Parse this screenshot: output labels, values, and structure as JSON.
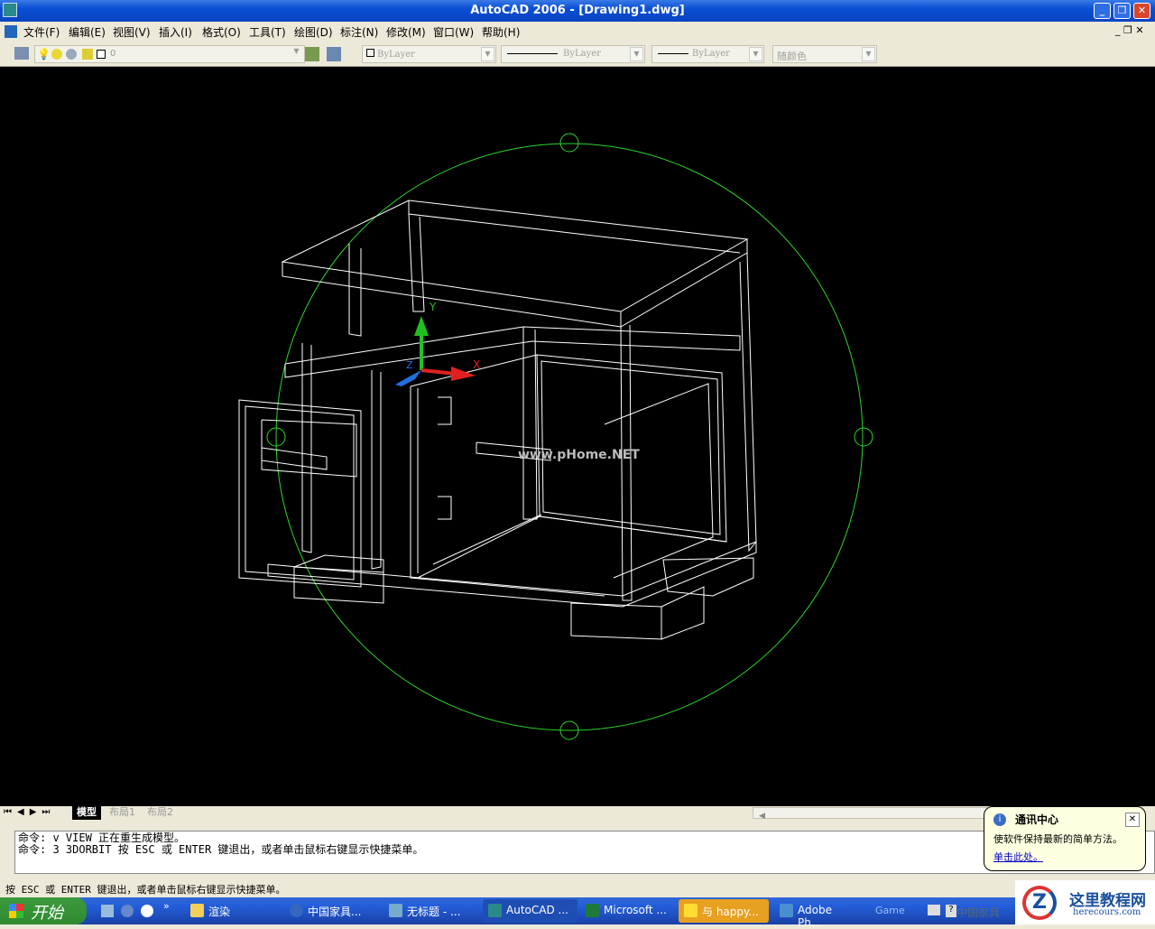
{
  "window": {
    "title": "AutoCAD 2006 - [Drawing1.dwg]",
    "min": "_",
    "restore": "❐",
    "close": "✕"
  },
  "menu": [
    "文件(F)",
    "编辑(E)",
    "视图(V)",
    "插入(I)",
    "格式(O)",
    "工具(T)",
    "绘图(D)",
    "标注(N)",
    "修改(M)",
    "窗口(W)",
    "帮助(H)"
  ],
  "toolbar": {
    "layer": "0",
    "color": "ByLayer",
    "linetype": "ByLayer",
    "lineweight": "ByLayer",
    "plotstyle": "随颜色"
  },
  "canvas": {
    "watermark": "www.pHome.NET",
    "ucs": {
      "x": "X",
      "y": "Y",
      "z": "Z"
    },
    "colors": {
      "orbit": "#2bd52b",
      "wire": "#ffffff",
      "x": "#e02020",
      "y": "#20c020",
      "z": "#2070e0"
    }
  },
  "tabs": [
    "模型",
    "布局1",
    "布局2"
  ],
  "command": {
    "lines": [
      "命令: v VIEW 正在重生成模型。",
      "命令: 3 3DORBIT 按 ESC 或 ENTER 键退出，或者单击鼠标右键显示快捷菜单。"
    ]
  },
  "status": "按 ESC 或 ENTER 键退出，或者单击鼠标右键显示快捷菜单。",
  "balloon": {
    "title": "通讯中心",
    "body": "使软件保持最新的简单方法。",
    "link": "单击此处。",
    "close": "✕"
  },
  "taskbar": {
    "start": "开始",
    "tasks": [
      "渲染",
      "中国家具...",
      "无标题 - ...",
      "AutoCAD ...",
      "Microsoft ...",
      "与 happy...",
      "Adobe Ph..."
    ],
    "toolbar_label": "Game",
    "tray_text": "中国家具"
  },
  "logo": {
    "name": "这里教程网",
    "url": "herecours.com"
  }
}
